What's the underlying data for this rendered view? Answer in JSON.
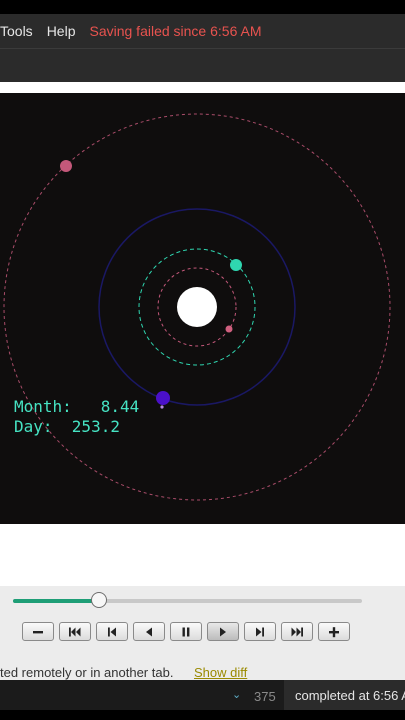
{
  "menu": {
    "items": [
      "Tools",
      "Help"
    ],
    "save_status": "Saving failed since 6:56 AM"
  },
  "readout": {
    "month_label": "Month:",
    "month_value": "8.44",
    "day_label": "Day:",
    "day_value": "253.2"
  },
  "timeline": {
    "progress": 0.247
  },
  "playback": {
    "buttons": [
      {
        "name": "slower-button",
        "icon": "minus"
      },
      {
        "name": "skip-to-start-button",
        "icon": "skip-start"
      },
      {
        "name": "step-back-button",
        "icon": "step-back"
      },
      {
        "name": "play-reverse-button",
        "icon": "play-reverse"
      },
      {
        "name": "pause-button",
        "icon": "pause"
      },
      {
        "name": "play-button",
        "icon": "play",
        "active": true
      },
      {
        "name": "step-forward-button",
        "icon": "step-forward"
      },
      {
        "name": "skip-to-end-button",
        "icon": "skip-end"
      },
      {
        "name": "faster-button",
        "icon": "plus"
      }
    ]
  },
  "notice": {
    "text": "ted remotely or in another tab.",
    "link": "Show diff"
  },
  "status": {
    "count": "375",
    "message": "completed at 6:56 A"
  },
  "colors": {
    "menu_bg": "#2b2b2b",
    "error_text": "#e8534f",
    "readout_text": "#46e3c3",
    "slider_fill": "#1e9e76",
    "link": "#9a8a00",
    "orbit_pink": "#c4587a",
    "orbit_teal": "#2fd6b0",
    "orbit_blue": "#1c1a6e"
  }
}
